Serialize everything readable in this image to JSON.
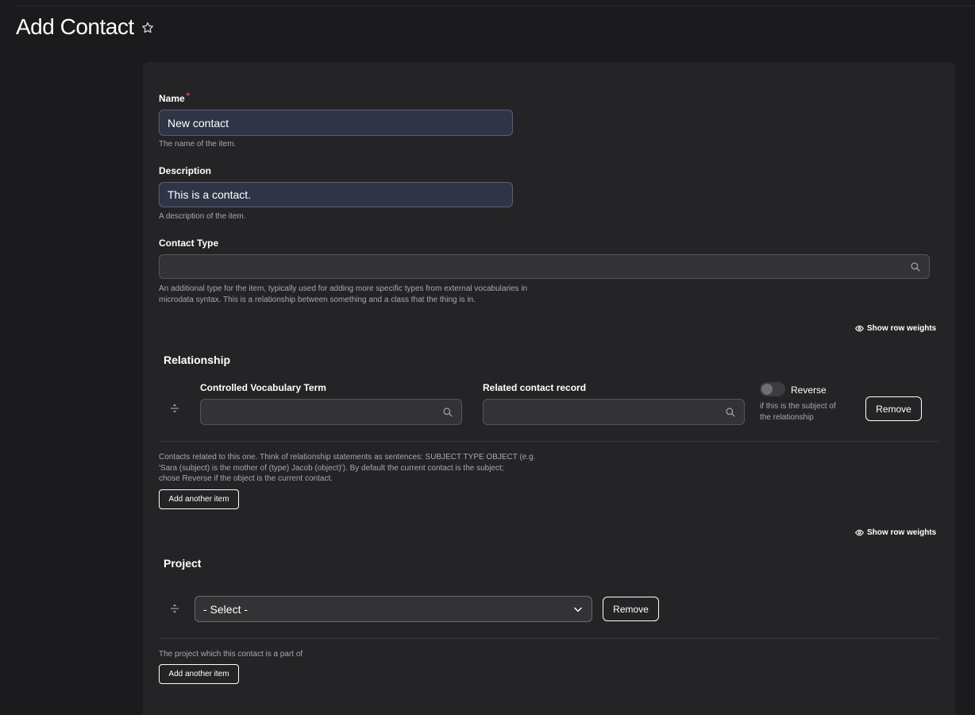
{
  "page": {
    "title": "Add Contact"
  },
  "fields": {
    "name": {
      "label": "Name",
      "required_mark": "*",
      "value": "New contact",
      "help": "The name of the item."
    },
    "description": {
      "label": "Description",
      "value": "This is a contact.",
      "help": "A description of the item."
    },
    "contact_type": {
      "label": "Contact Type",
      "value": "",
      "help_line1": "An additional type for the item, typically used for adding more specific types from external vocabularies in",
      "help_line2": "microdata syntax. This is a relationship between something and a class that the thing is in."
    }
  },
  "relationship": {
    "show_row_weights": "Show row weights",
    "title": "Relationship",
    "vocab_label": "Controlled Vocabulary Term",
    "related_label": "Related contact record",
    "reverse_label": "Reverse",
    "reverse_on": false,
    "reverse_help_line1": "if this is the subject of",
    "reverse_help_line2": "the relationship",
    "remove_label": "Remove",
    "help_line1": "Contacts related to this one. Think of relationship statements as sentences: SUBJECT TYPE OBJECT (e.g.",
    "help_line2": "'Sara (subject) is the mother of (type) Jacob (object)'). By default the current contact is the subject;",
    "help_line3": "chose Reverse if the object is the current contact.",
    "add_label": "Add another item"
  },
  "project": {
    "show_row_weights": "Show row weights",
    "title": "Project",
    "select_value": "- Select -",
    "remove_label": "Remove",
    "help": "The project which this contact is a part of",
    "add_label": "Add another item"
  },
  "icons": {
    "star": "star-outline",
    "search": "magnifier",
    "eye": "eye",
    "drag": "drag-handle",
    "chevron": "chevron-down"
  }
}
